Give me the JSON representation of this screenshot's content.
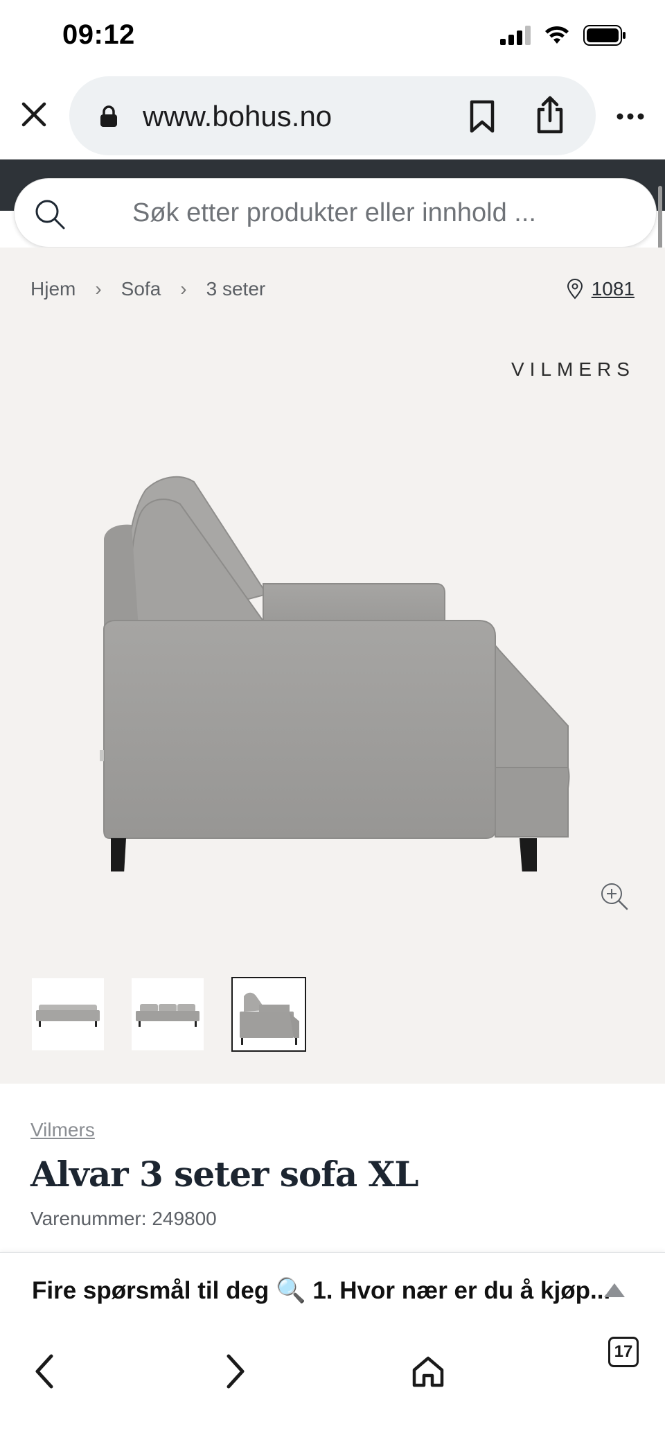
{
  "status_bar": {
    "time": "09:12"
  },
  "browser": {
    "url": "www.bohus.no",
    "tab_count": "17"
  },
  "site": {
    "search_placeholder": "Søk etter produkter eller innhold ..."
  },
  "breadcrumb": [
    "Hjem",
    "Sofa",
    "3 seter"
  ],
  "store": {
    "label": "1081"
  },
  "gallery": {
    "brand_logo": "VILMERS",
    "thumbnails": 3,
    "active_thumbnail": 3
  },
  "product": {
    "brand": "Vilmers",
    "title": "Alvar 3 seter sofa XL",
    "sku": "Varenummer: 249800"
  },
  "banner": {
    "question": "Fire spørsmål til deg 🔍 1. Hvor nær er du å kjøp..."
  },
  "colors": {
    "header_dark": "#2e3338",
    "gallery_bg": "#f4f2f0",
    "sofa_fabric": "#9e9d9b"
  }
}
